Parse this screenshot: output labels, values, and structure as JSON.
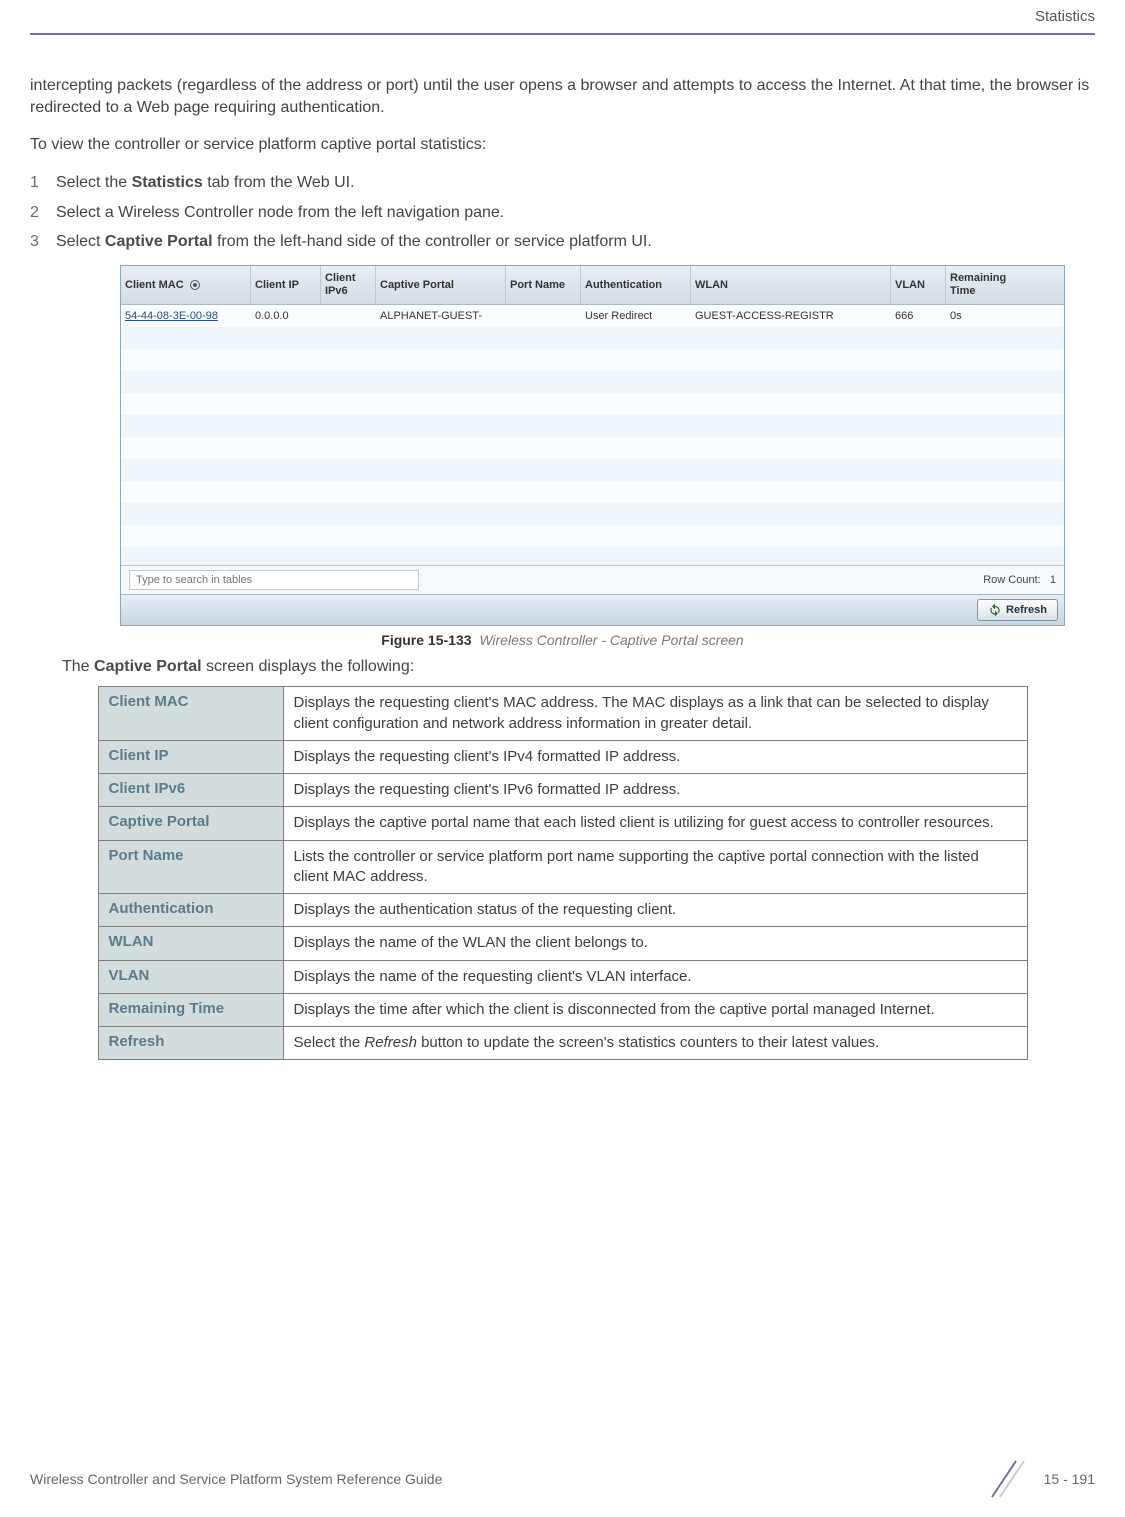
{
  "header": {
    "section_title": "Statistics"
  },
  "intro": {
    "para1": "intercepting packets (regardless of the address or port) until the user opens a browser and attempts to access the Internet. At that time, the browser is redirected to a Web page requiring authentication.",
    "para2": "To view the controller or service platform captive portal statistics:"
  },
  "steps": [
    {
      "num": "1",
      "pre": "Select the ",
      "bold": "Statistics",
      "post": " tab from the Web UI."
    },
    {
      "num": "2",
      "pre": "Select a Wireless Controller node from the left navigation pane.",
      "bold": "",
      "post": ""
    },
    {
      "num": "3",
      "pre": "Select ",
      "bold": "Captive Portal",
      "post": " from the left-hand side of the controller or service platform UI."
    }
  ],
  "screenshot": {
    "headers": {
      "client_mac": "Client MAC",
      "client_ip": "Client IP",
      "client_ipv6": "Client IPv6",
      "captive_portal": "Captive Portal",
      "port_name": "Port Name",
      "authentication": "Authentication",
      "wlan": "WLAN",
      "vlan": "VLAN",
      "remaining_time": "Remaining Time"
    },
    "row": {
      "client_mac": "54-44-08-3E-00-98",
      "client_ip": "0.0.0.0",
      "client_ipv6": "",
      "captive_portal": "ALPHANET-GUEST-",
      "port_name": "",
      "authentication": "User Redirect",
      "wlan": "GUEST-ACCESS-REGISTR",
      "vlan": "666",
      "remaining_time": "0s"
    },
    "search_placeholder": "Type to search in tables",
    "row_count_label": "Row Count:",
    "row_count_value": "1",
    "refresh_label": "Refresh"
  },
  "figure": {
    "label": "Figure 15-133",
    "desc": "Wireless Controller - Captive Portal screen"
  },
  "table_intro": {
    "pre": "The ",
    "bold": "Captive Portal",
    "post": " screen displays the following:"
  },
  "desc_table": [
    {
      "label": "Client MAC",
      "desc": "Displays the requesting client's MAC address. The MAC displays as a link that can be selected to display client configuration and network address information in greater detail."
    },
    {
      "label": "Client IP",
      "desc": "Displays the requesting client's IPv4 formatted IP address."
    },
    {
      "label": "Client IPv6",
      "desc": "Displays the requesting client's IPv6 formatted IP address."
    },
    {
      "label": "Captive Portal",
      "desc": "Displays the captive portal name that each listed client is utilizing for guest access to controller resources."
    },
    {
      "label": "Port Name",
      "desc": "Lists the controller or service platform port name supporting the captive portal connection with the listed client MAC address."
    },
    {
      "label": "Authentication",
      "desc": "Displays the authentication status of the requesting client."
    },
    {
      "label": "WLAN",
      "desc": "Displays the name of the WLAN the client belongs to."
    },
    {
      "label": "VLAN",
      "desc": "Displays the name of the requesting client's VLAN interface."
    },
    {
      "label": "Remaining Time",
      "desc": "Displays the time after which the client is disconnected from the captive portal managed Internet."
    },
    {
      "label": "Refresh",
      "desc": "Select the Refresh button to update the screen's statistics counters to their latest values.",
      "italic_word": "Refresh"
    }
  ],
  "footer": {
    "guide_title": "Wireless Controller and Service Platform System Reference Guide",
    "page_num": "15 - 191"
  }
}
